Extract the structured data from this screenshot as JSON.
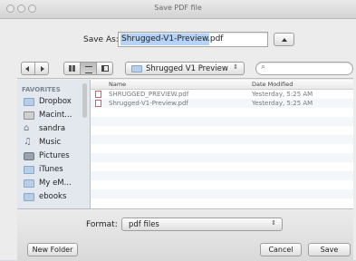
{
  "window": {
    "title": "Save PDF file"
  },
  "save_as": {
    "label": "Save As:",
    "value_prefix": "Shrugged-V1-Preview",
    "value_suffix": ".pdf"
  },
  "toolbar": {
    "location": "Shrugged V1 Preview",
    "search_placeholder": ""
  },
  "sidebar": {
    "heading": "FAVORITES",
    "items": [
      {
        "label": "Dropbox",
        "icon": "folder-icon"
      },
      {
        "label": "Macint...",
        "icon": "hard-drive-icon"
      },
      {
        "label": "sandra",
        "icon": "home-icon"
      },
      {
        "label": "Music",
        "icon": "music-icon"
      },
      {
        "label": "Pictures",
        "icon": "camera-icon"
      },
      {
        "label": "iTunes",
        "icon": "folder-icon"
      },
      {
        "label": "My eM...",
        "icon": "folder-icon"
      },
      {
        "label": "ebooks",
        "icon": "folder-icon"
      }
    ]
  },
  "files": {
    "columns": {
      "name": "Name",
      "date": "Date Modified"
    },
    "rows": [
      {
        "name": "SHRUGGED_PREVIEW.pdf",
        "date": "Yesterday, 5:25 AM"
      },
      {
        "name": "Shrugged-V1-Preview.pdf",
        "date": "Yesterday, 5:25 AM"
      }
    ]
  },
  "format": {
    "label": "Format:",
    "value": "pdf files"
  },
  "buttons": {
    "new_folder": "New Folder",
    "cancel": "Cancel",
    "save": "Save"
  }
}
